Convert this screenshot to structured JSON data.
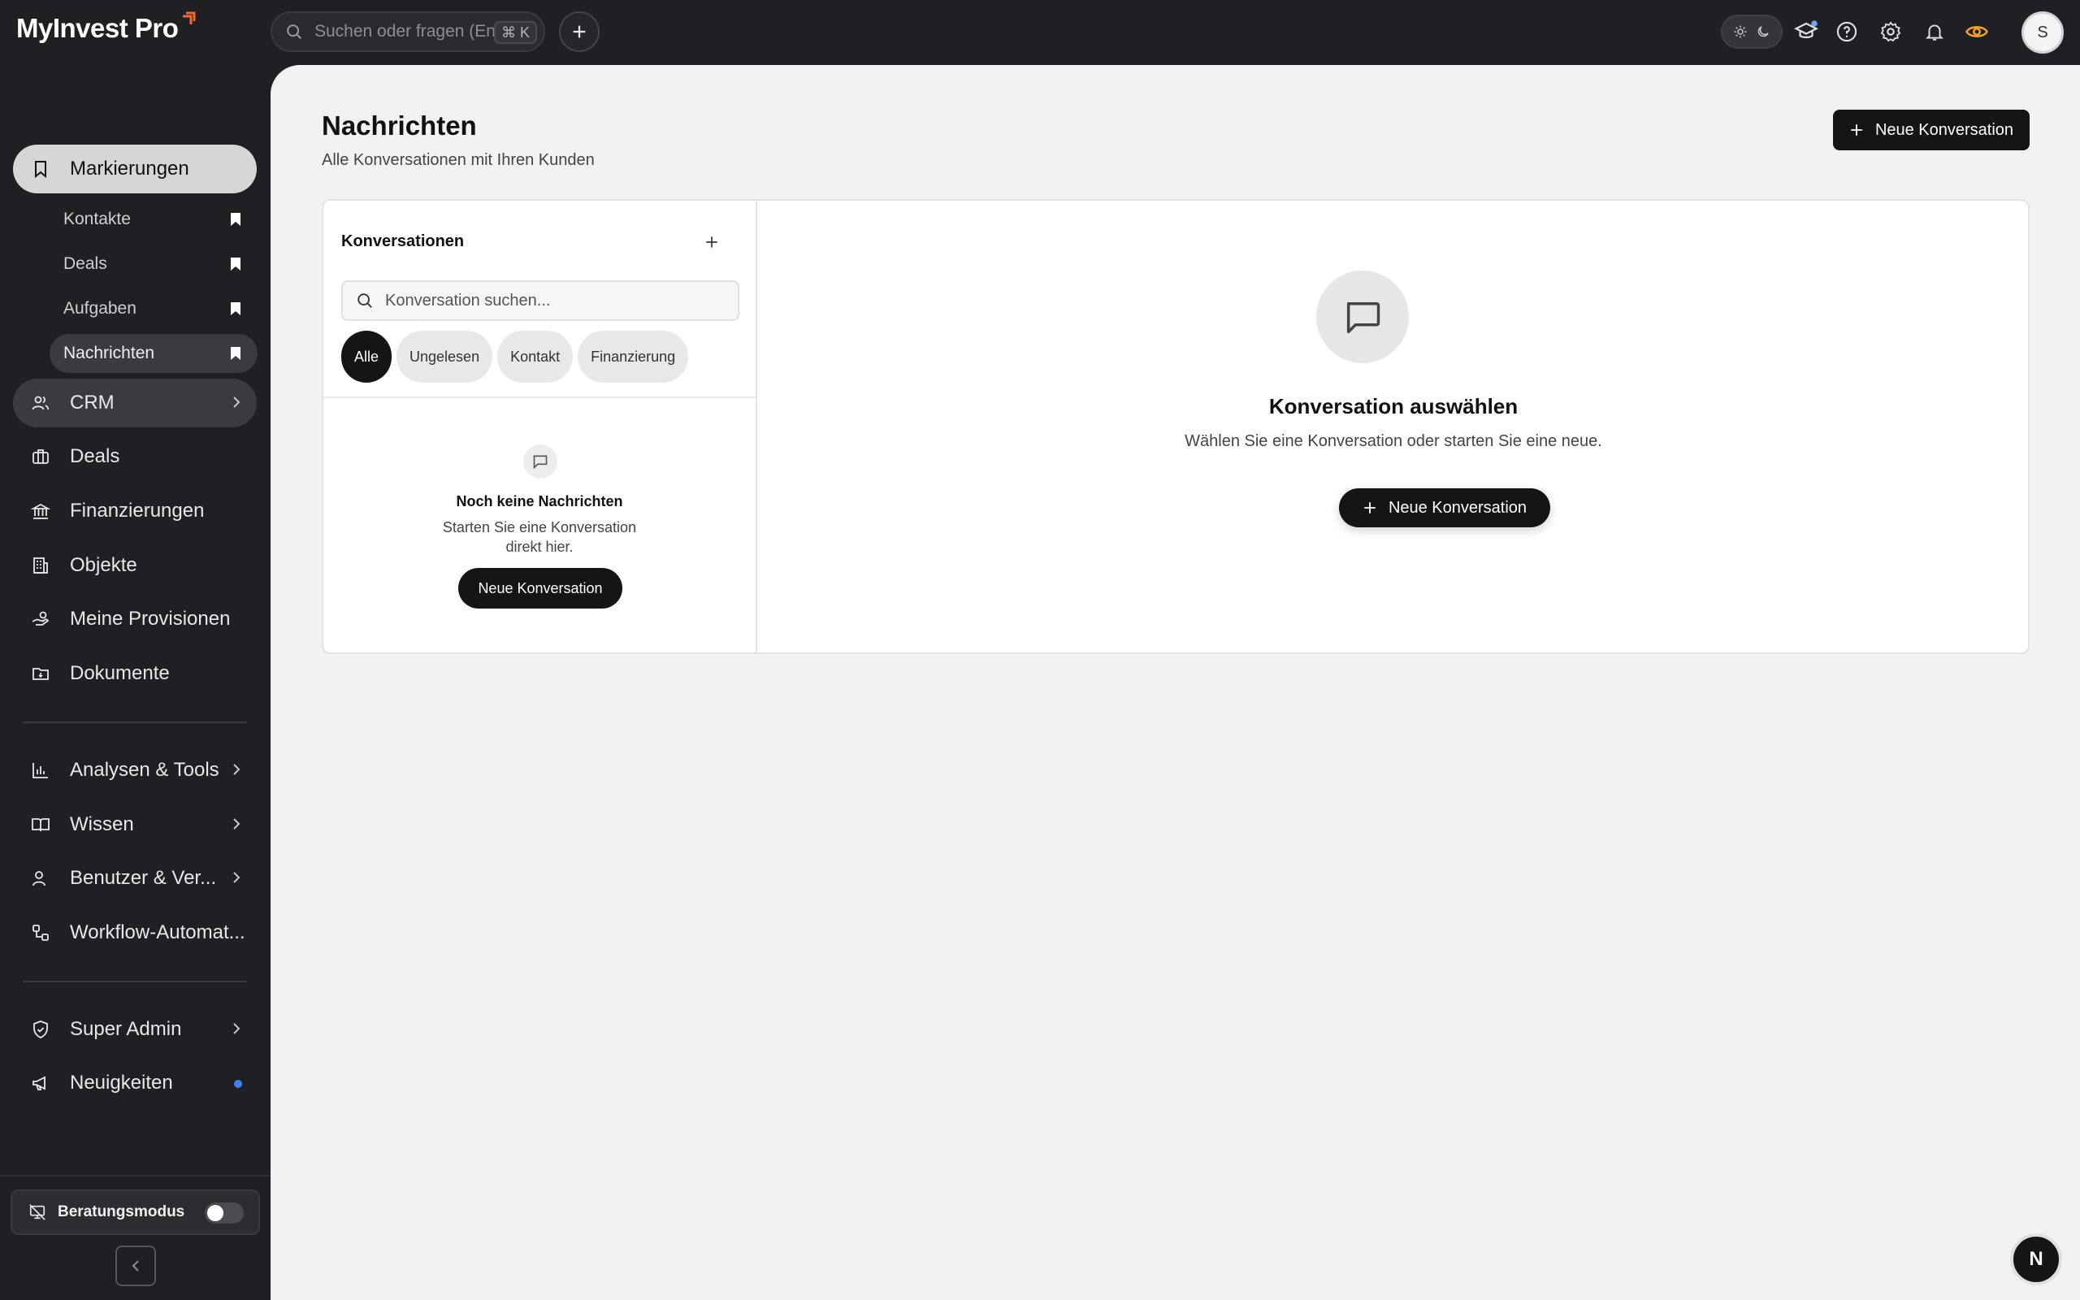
{
  "brand": {
    "name": "MyInvest Pro",
    "accent": "#f26a2e"
  },
  "topbar": {
    "search_placeholder": "Suchen oder fragen (Enter)",
    "search_shortcut": "⌘ K",
    "user_initial": "S"
  },
  "sidebar": {
    "bookmarks": {
      "label": "Markierungen",
      "items": [
        {
          "label": "Kontakte"
        },
        {
          "label": "Deals"
        },
        {
          "label": "Aufgaben"
        },
        {
          "label": "Nachrichten"
        }
      ]
    },
    "crm": "CRM",
    "deals": "Deals",
    "finanzierungen": "Finanzierungen",
    "objekte": "Objekte",
    "provisionen": "Meine Provisionen",
    "dokumente": "Dokumente",
    "analysen": "Analysen & Tools",
    "wissen": "Wissen",
    "benutzer": "Benutzer & Ver...",
    "workflow": "Workflow-Automat...",
    "superadmin": "Super Admin",
    "neuigkeiten": "Neuigkeiten",
    "beratungsmodus": "Beratungsmodus"
  },
  "main": {
    "title": "Nachrichten",
    "subtitle": "Alle Konversationen mit Ihren Kunden",
    "new_conversation": "Neue Konversation",
    "list": {
      "title": "Konversationen",
      "search_placeholder": "Konversation suchen...",
      "filters": [
        {
          "label": "Alle"
        },
        {
          "label": "Ungelesen"
        },
        {
          "label": "Kontakt"
        },
        {
          "label": "Finanzierung"
        }
      ],
      "empty_title": "Noch keine Nachrichten",
      "empty_desc": "Starten Sie eine Konversation direkt hier.",
      "empty_button": "Neue Konversation"
    },
    "detail": {
      "title": "Konversation auswählen",
      "desc": "Wählen Sie eine Konversation oder starten Sie eine neue.",
      "button": "Neue Konversation"
    }
  },
  "devtools_badge": "N"
}
